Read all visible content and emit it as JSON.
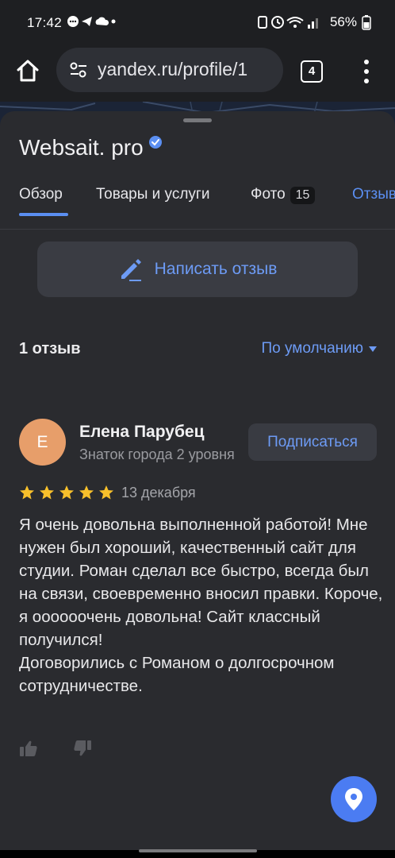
{
  "status_bar": {
    "time": "17:42",
    "battery": "56%"
  },
  "browser": {
    "url": "yandex.ru/profile/1",
    "tab_count": "4"
  },
  "org": {
    "name": "Websait. pro"
  },
  "tabs": [
    {
      "label": "Обзор",
      "active": true
    },
    {
      "label": "Товары и услуги"
    },
    {
      "label": "Фото",
      "badge": "15"
    },
    {
      "label": "Отзывы"
    }
  ],
  "actions": {
    "write_review": "Написать отзыв"
  },
  "reviews": {
    "count_label": "1 отзыв",
    "sort_label": "По умолчанию",
    "items": [
      {
        "avatar_letter": "Е",
        "author": "Елена Парубец",
        "author_status": "Знаток города 2 уровня",
        "subscribe_label": "Подписаться",
        "rating": 5,
        "date": "13 декабря",
        "text_lines": [
          "Я очень довольна выполненной работой! Мне нужен был хороший, качественный сайт для студии. Роман сделал все быстро, всегда был на связи, своевременно вносил правки. Короче, я оооооочень довольна! Сайт классный получился!",
          "Договорились с Романом о долгосрочном сотрудничестве."
        ]
      }
    ]
  },
  "colors": {
    "accent": "#5b8ff2",
    "sheet_bg": "#2a2b2f",
    "avatar_bg": "#e79e6a",
    "star": "#f8c02b",
    "fab": "#4b7cf2"
  },
  "icons": [
    "home-icon",
    "site-settings-icon",
    "tabs-icon",
    "more-vert-icon",
    "verified-icon",
    "pencil-icon",
    "caret-down-icon",
    "star-icon",
    "thumb-up-icon",
    "thumb-down-icon",
    "map-pin-icon"
  ]
}
